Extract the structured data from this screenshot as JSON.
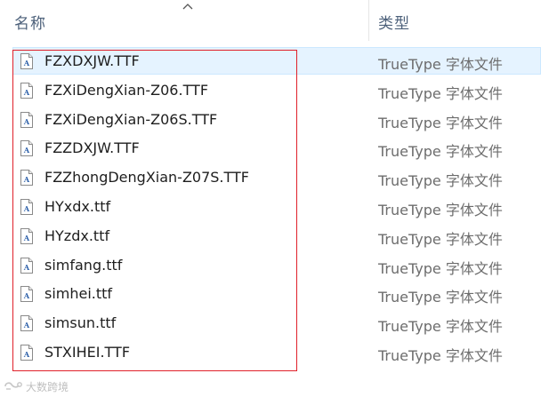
{
  "header": {
    "name_label": "名称",
    "type_label": "类型",
    "sort_icon": "chevron-up-icon"
  },
  "files": [
    {
      "name": "FZXDXJW.TTF",
      "type": "TrueType 字体文件"
    },
    {
      "name": "FZXiDengXian-Z06.TTF",
      "type": "TrueType 字体文件"
    },
    {
      "name": "FZXiDengXian-Z06S.TTF",
      "type": "TrueType 字体文件"
    },
    {
      "name": "FZZDXJW.TTF",
      "type": "TrueType 字体文件"
    },
    {
      "name": "FZZhongDengXian-Z07S.TTF",
      "type": "TrueType 字体文件"
    },
    {
      "name": "HYxdx.ttf",
      "type": "TrueType 字体文件"
    },
    {
      "name": "HYzdx.ttf",
      "type": "TrueType 字体文件"
    },
    {
      "name": "simfang.ttf",
      "type": "TrueType 字体文件"
    },
    {
      "name": "simhei.ttf",
      "type": "TrueType 字体文件"
    },
    {
      "name": "simsun.ttf",
      "type": "TrueType 字体文件"
    },
    {
      "name": "STXIHEI.TTF",
      "type": "TrueType 字体文件"
    }
  ],
  "highlighted_row": 0,
  "annotation_color": "#e0202a",
  "file_icon": "font-file-icon",
  "watermark": {
    "text": "大数跨境",
    "icon": "watermark-logo-icon"
  }
}
